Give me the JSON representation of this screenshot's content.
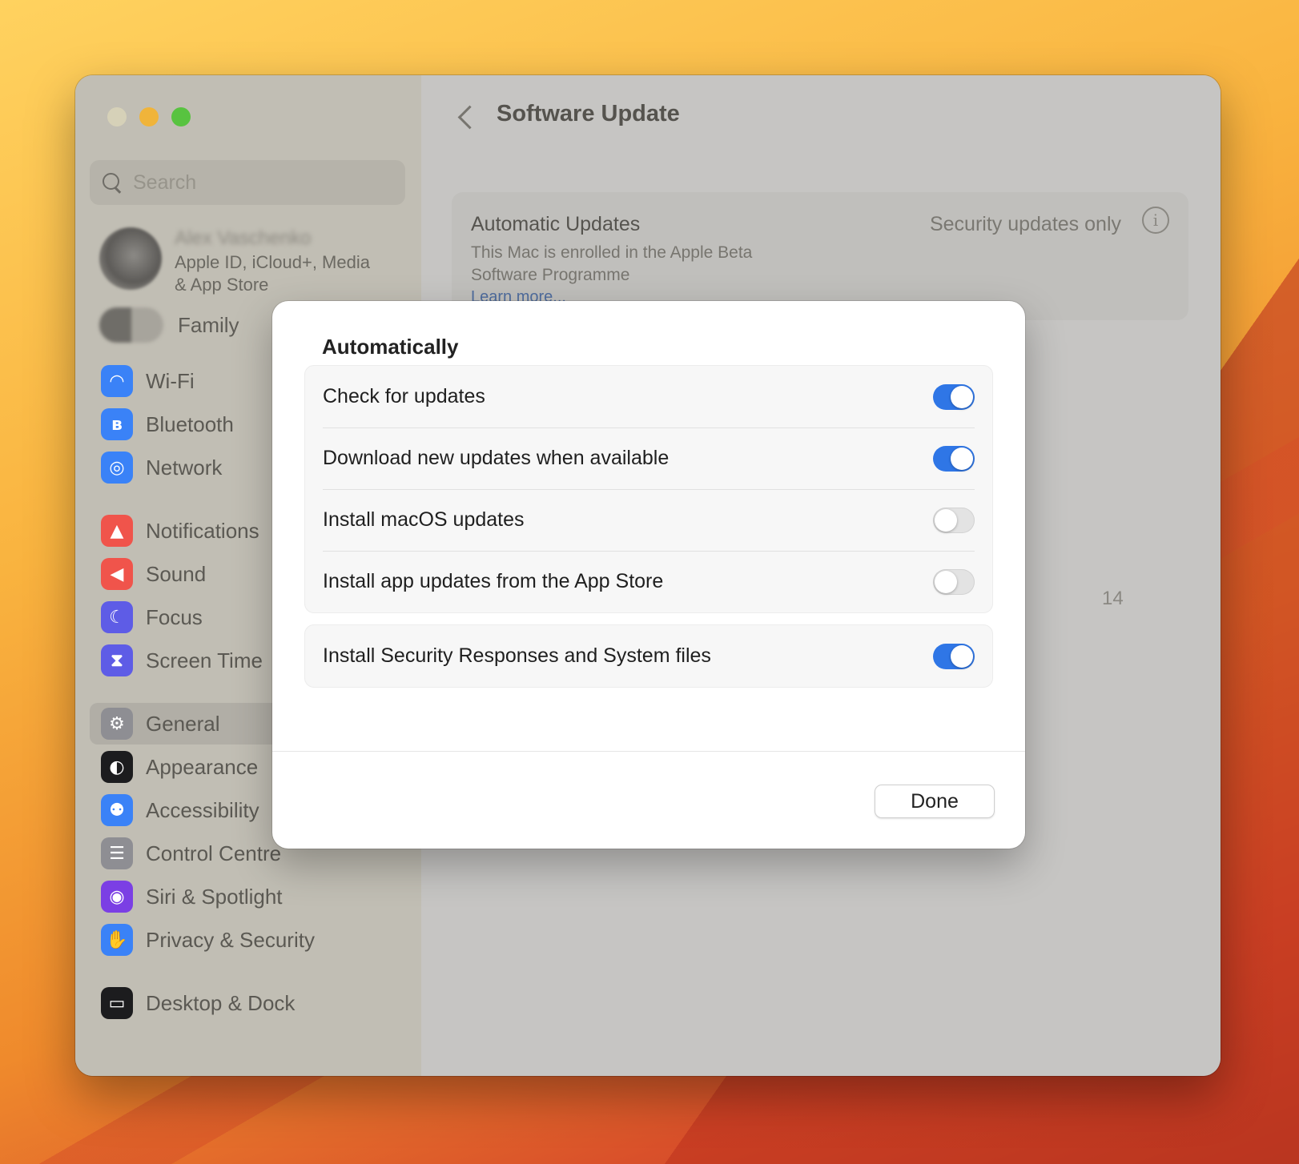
{
  "window": {
    "title": "Software Update"
  },
  "sidebar": {
    "search_placeholder": "Search",
    "account": {
      "name": "Alex Vaschenko",
      "subtitle_line1": "Apple ID, iCloud+, Media",
      "subtitle_line2": "& App Store"
    },
    "family_label": "Family",
    "items": [
      {
        "label": "Wi-Fi",
        "icon": "wifi-icon",
        "color": "#3a82f7"
      },
      {
        "label": "Bluetooth",
        "icon": "bluetooth-icon",
        "color": "#3a82f7"
      },
      {
        "label": "Network",
        "icon": "globe-icon",
        "color": "#3a82f7"
      },
      {
        "label": "Notifications",
        "icon": "bell-icon",
        "color": "#f0544b"
      },
      {
        "label": "Sound",
        "icon": "speaker-icon",
        "color": "#f0544b"
      },
      {
        "label": "Focus",
        "icon": "moon-icon",
        "color": "#5e5ce6"
      },
      {
        "label": "Screen Time",
        "icon": "hourglass-icon",
        "color": "#5e5ce6"
      },
      {
        "label": "General",
        "icon": "gear-icon",
        "color": "#8e8e93"
      },
      {
        "label": "Appearance",
        "icon": "appearance-icon",
        "color": "#1c1c1e"
      },
      {
        "label": "Accessibility",
        "icon": "accessibility-icon",
        "color": "#3a82f7"
      },
      {
        "label": "Control Centre",
        "icon": "control-centre-icon",
        "color": "#8e8e93"
      },
      {
        "label": "Siri & Spotlight",
        "icon": "siri-icon",
        "color": "#7b3fe4"
      },
      {
        "label": "Privacy & Security",
        "icon": "hand-icon",
        "color": "#3a82f7"
      },
      {
        "label": "Desktop & Dock",
        "icon": "dock-icon",
        "color": "#1c1c1e"
      }
    ],
    "selected": "General"
  },
  "main": {
    "automatic_updates": {
      "title": "Automatic Updates",
      "description": "This Mac is enrolled in the Apple Beta Software Programme",
      "link": "Learn more...",
      "value": "Security updates only"
    },
    "partial_text": "14",
    "help_label": "?"
  },
  "modal": {
    "title": "Automatically",
    "options": [
      {
        "label": "Check for updates",
        "on": true
      },
      {
        "label": "Download new updates when available",
        "on": true
      },
      {
        "label": "Install macOS updates",
        "on": false
      },
      {
        "label": "Install app updates from the App Store",
        "on": false
      }
    ],
    "security_option": {
      "label": "Install Security Responses and System files",
      "on": true
    },
    "done_label": "Done"
  }
}
